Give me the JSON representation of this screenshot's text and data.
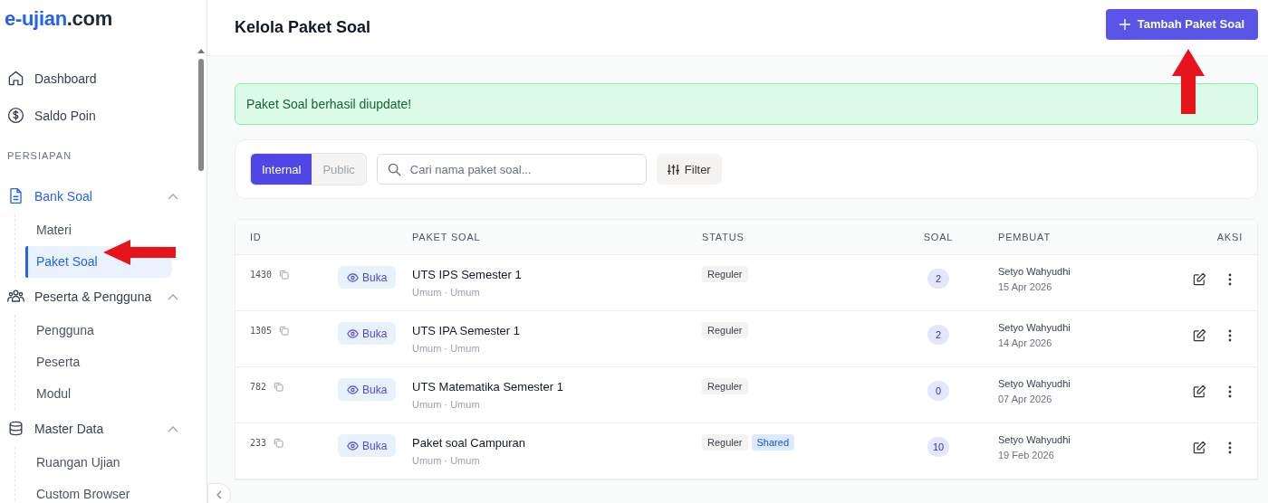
{
  "logo": {
    "name": "e-ujian",
    "domain": ".com"
  },
  "sidebar": {
    "items": [
      {
        "kind": "link",
        "label": "Dashboard",
        "selected": false
      },
      {
        "kind": "link",
        "label": "Saldo Poin",
        "selected": false
      },
      {
        "kind": "section",
        "label": "PERSIAPAN"
      },
      {
        "kind": "group",
        "label": "Bank Soal",
        "expanded": true,
        "selected": true,
        "children": [
          {
            "label": "Materi",
            "selected": false
          },
          {
            "label": "Paket Soal",
            "selected": true
          }
        ]
      },
      {
        "kind": "group",
        "label": "Peserta & Pengguna",
        "expanded": true,
        "selected": false,
        "children": [
          {
            "label": "Pengguna",
            "selected": false
          },
          {
            "label": "Peserta",
            "selected": false
          },
          {
            "label": "Modul",
            "selected": false
          }
        ]
      },
      {
        "kind": "group",
        "label": "Master Data",
        "expanded": true,
        "selected": false,
        "children": [
          {
            "label": "Ruangan Ujian",
            "selected": false
          },
          {
            "label": "Custom Browser",
            "selected": false
          }
        ]
      }
    ]
  },
  "header": {
    "title": "Kelola Paket Soal",
    "add_button": "Tambah Paket Soal"
  },
  "alert": {
    "message": "Paket Soal berhasil diupdate!"
  },
  "toolbar": {
    "tabs": [
      {
        "label": "Internal",
        "selected": true
      },
      {
        "label": "Public",
        "selected": false
      }
    ],
    "search": {
      "placeholder": "Cari nama paket soal..."
    },
    "filter_button": "Filter"
  },
  "table": {
    "columns": [
      "ID",
      "PAKET SOAL",
      "STATUS",
      "SOAL",
      "PEMBUAT",
      "AKSI"
    ],
    "rows": [
      {
        "id": "1430",
        "open": "Buka",
        "name": "UTS IPS Semester 1",
        "meta": "Umum · Umum",
        "tags": [
          {
            "label": "Reguler",
            "kind": "neutral"
          }
        ],
        "count": "2",
        "author": "Setyo Wahyudhi",
        "date": "15 Apr 2026"
      },
      {
        "id": "1305",
        "open": "Buka",
        "name": "UTS IPA Semester 1",
        "meta": "Umum · Umum",
        "tags": [
          {
            "label": "Reguler",
            "kind": "neutral"
          }
        ],
        "count": "2",
        "author": "Setyo Wahyudhi",
        "date": "14 Apr 2026"
      },
      {
        "id": "782",
        "open": "Buka",
        "name": "UTS Matematika Semester 1",
        "meta": "Umum · Umum",
        "tags": [
          {
            "label": "Reguler",
            "kind": "neutral"
          }
        ],
        "count": "0",
        "author": "Setyo Wahyudhi",
        "date": "07 Apr 2026"
      },
      {
        "id": "233",
        "open": "Buka",
        "name": "Paket soal Campuran",
        "meta": "Umum · Umum",
        "tags": [
          {
            "label": "Reguler",
            "kind": "neutral"
          },
          {
            "label": "Shared",
            "kind": "shared"
          }
        ],
        "count": "10",
        "author": "Setyo Wahyudhi",
        "date": "19 Feb 2026"
      }
    ]
  }
}
